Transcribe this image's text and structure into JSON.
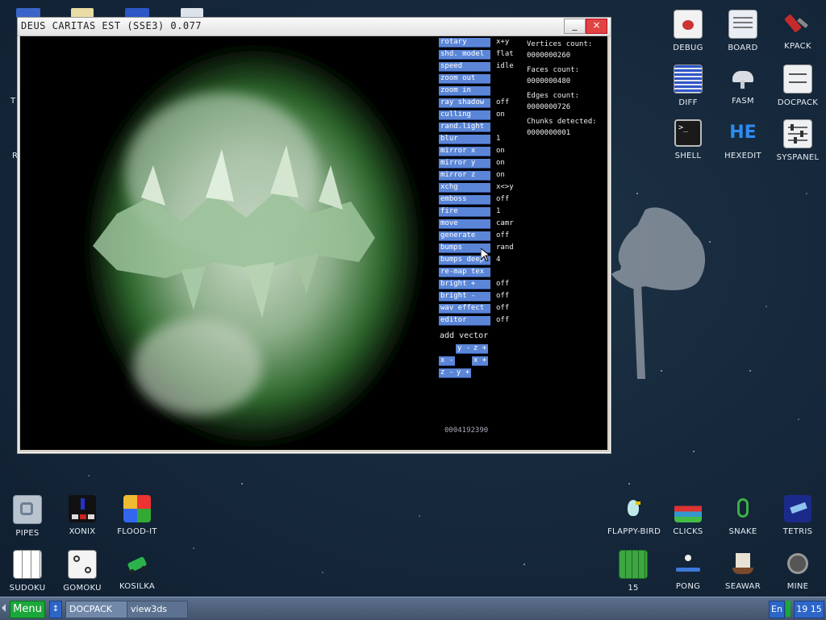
{
  "window": {
    "title": "DEUS CARITAS EST (SSE3) 0.077",
    "minimize_glyph": "_",
    "close_glyph": "×"
  },
  "menu": [
    {
      "label": "rotary",
      "value": "x+y"
    },
    {
      "label": "shd. model",
      "value": "flat"
    },
    {
      "label": "speed",
      "value": "idle"
    },
    {
      "label": "zoom out",
      "value": ""
    },
    {
      "label": "zoom in",
      "value": ""
    },
    {
      "label": "ray shadow",
      "value": "off"
    },
    {
      "label": "culling",
      "value": "on"
    },
    {
      "label": "rand.light",
      "value": ""
    },
    {
      "label": "blur",
      "value": "1"
    },
    {
      "label": "mirror x",
      "value": "on"
    },
    {
      "label": "mirror y",
      "value": "on"
    },
    {
      "label": "mirror z",
      "value": "on"
    },
    {
      "label": "xchg",
      "value": "x<>y"
    },
    {
      "label": "emboss",
      "value": "off"
    },
    {
      "label": "fire",
      "value": "1"
    },
    {
      "label": "move",
      "value": "camr"
    },
    {
      "label": "generate",
      "value": "off"
    },
    {
      "label": "bumps",
      "value": "rand"
    },
    {
      "label": "bumps deep",
      "value": "4"
    },
    {
      "label": "re-map tex",
      "value": ""
    },
    {
      "label": "bright +",
      "value": "off"
    },
    {
      "label": "bright -",
      "value": "off"
    },
    {
      "label": "wav effect",
      "value": "off"
    },
    {
      "label": "editor",
      "value": "off"
    }
  ],
  "vector": {
    "label": "add vector",
    "buttons": [
      "y -",
      "z +",
      "x -",
      "x +",
      "z -",
      "y +"
    ]
  },
  "stats": {
    "vertices_label": "Vertices count:",
    "vertices": "0000000260",
    "faces_label": "Faces count:",
    "faces": "0000000480",
    "edges_label": "Edges count:",
    "edges": "0000000726",
    "chunks_label": "Chunks detected:",
    "chunks": "0000000001"
  },
  "bottom_counter": "0004192390",
  "desktop_icons_right": [
    {
      "label": "DEBUG",
      "icon": "debug-icon"
    },
    {
      "label": "BOARD",
      "icon": "board-icon"
    },
    {
      "label": "KPACK",
      "icon": "kpack-icon"
    },
    {
      "label": "DIFF",
      "icon": "diff-icon"
    },
    {
      "label": "FASM",
      "icon": "fasm-icon"
    },
    {
      "label": "DOCPACK",
      "icon": "docpack-icon"
    },
    {
      "label": "SHELL",
      "icon": "shell-icon"
    },
    {
      "label": "HEXEDIT",
      "icon": "hexedit-icon"
    },
    {
      "label": "SYSPANEL",
      "icon": "syspanel-icon"
    }
  ],
  "hexedit_glyph": "HE",
  "shell_glyph": ">_",
  "desktop_icons_bottom_left": [
    {
      "label": "PIPES"
    },
    {
      "label": "XONIX"
    },
    {
      "label": "FLOOD-IT"
    },
    {
      "label": "SUDOKU"
    },
    {
      "label": "GOMOKU"
    },
    {
      "label": "KOSILKA"
    }
  ],
  "desktop_icons_bottom_right": [
    {
      "label": "FLAPPY-BIRD"
    },
    {
      "label": "CLICKS"
    },
    {
      "label": "SNAKE"
    },
    {
      "label": "TETRIS"
    },
    {
      "label": "15"
    },
    {
      "label": "PONG"
    },
    {
      "label": "SEAWAR"
    },
    {
      "label": "MINE"
    }
  ],
  "partial_left_letters": [
    "T",
    "R"
  ],
  "taskbar": {
    "menu_label": "Menu",
    "tasks": [
      "DOCPACK",
      "view3ds"
    ],
    "lang": "En",
    "clock": "19 15"
  },
  "colors": {
    "menu_button": "#5b86d8",
    "taskbar": "#4c5d78",
    "menu_green": "#1aa83a"
  }
}
